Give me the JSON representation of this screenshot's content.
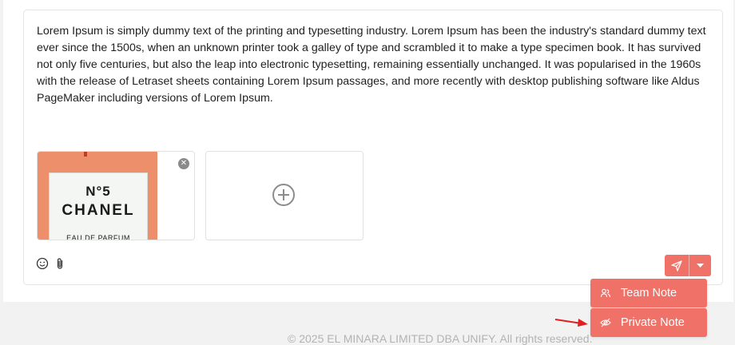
{
  "composer": {
    "message": "Lorem Ipsum is simply dummy text of the printing and typesetting industry. Lorem Ipsum has been the industry's standard dummy text ever since the 1500s, when an unknown printer took a galley of type and scrambled it to make a type specimen book. It has survived not only five centuries, but also the leap into electronic typesetting, remaining essentially unchanged. It was popularised in the 1960s with the release of Letraset sheets containing Lorem Ipsum passages, and more recently with desktop publishing software like Aldus PageMaker including versions of Lorem Ipsum.",
    "attachment": {
      "image_line1": "N°5",
      "image_line2": "CHANEL",
      "image_line3": "EAU DE PARFUM",
      "remove_icon": "close-icon"
    },
    "add_attachment_icon": "plus-circle-icon",
    "tools": {
      "emoji_icon": "smiley-icon",
      "attach_icon": "paperclip-icon"
    },
    "send": {
      "send_icon": "paper-plane-icon",
      "dropdown_icon": "caret-down-icon"
    }
  },
  "note_menu": {
    "team_note_label": "Team Note",
    "team_note_icon": "users-icon",
    "private_note_label": "Private Note",
    "private_note_icon": "eye-off-icon"
  },
  "footer": {
    "copyright": "© 2025 EL MINARA LIMITED DBA UNIFY. All rights reserved."
  },
  "colors": {
    "accent": "#f07167",
    "annotation_arrow": "#e02020"
  }
}
